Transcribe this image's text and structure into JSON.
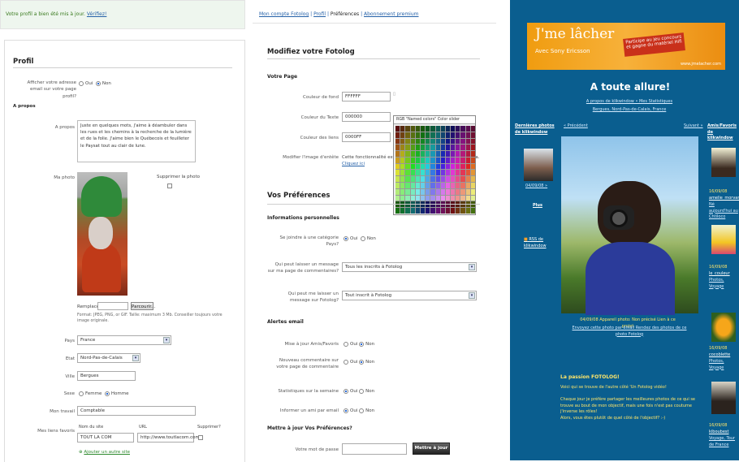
{
  "profile_panel": {
    "message": "Votre profil a bien été mis à jour.",
    "message_link": "Vérifiez!",
    "section_title": "Profil",
    "email_question": "Afficher votre adresse email sur votre page profil?",
    "radio_oui": "Oui",
    "radio_non": "Non",
    "apropos_heading": "A propos",
    "apropos_label": "A propos",
    "apropos_text": "Juste en quelques mots, j'aime à déambuler dans les rues et les chemins à la recherche de la lumière et de la folie. J'aime bien le Québecois et feuilleter le Paysat tout au clair de lune.",
    "photo_label": "Ma photo",
    "delete_photo": "Supprimer la photo",
    "browse_label": "Remplacer",
    "browse_button": "Parcourir...",
    "photo_hint": "Format: JPEG, PNG, or GIF. Taille: maximum 3 Mb. Conseiller toujours votre image originale.",
    "country_label": "Pays",
    "country_value": "France",
    "state_label": "Etat",
    "state_value": "Nord-Pas-de-Calais",
    "city_label": "Ville",
    "city_value": "Bergues",
    "sex_label": "Sexe",
    "sex_f": "Femme",
    "sex_m": "Homme",
    "job_label": "Mon travail",
    "job_value": "Comptable",
    "fav_label": "Mes liens favoris",
    "fav_col_name": "Nom du site",
    "fav_col_url": "URL",
    "fav_col_del": "Supprimer?",
    "fav_name": "TOUT LA COM",
    "fav_url": "http://www.toutlacom.com",
    "add_site": "Ajouter un autre site"
  },
  "prefs_panel": {
    "nav_account": "Mon compte Fotolog",
    "nav_profile": "Profil",
    "nav_prefs": "Préférences",
    "nav_premium": "Abonnement premium",
    "title": "Modifiez votre Fotolog",
    "page_heading": "Votre Page",
    "bg_label": "Couleur de fond",
    "bg_value": "FFFFFF",
    "text_label": "Couleur du Texte",
    "text_value": "000000",
    "link_label": "Couleur des liens",
    "link_value": "0000FF",
    "header_label": "Modifier l'image d'entête",
    "header_text": "Cette fonctionnalité est réservée aux membres Gold Camera.",
    "header_link": "Cliquez ici",
    "swatch_header": "RGB \"Named colors\" Color slider",
    "prefs_title": "Vos Préférences",
    "personal_heading": "Informations personnelles",
    "category_label": "Se joindre à une catégorie Pays?",
    "msg_label": "Qui peut laisser un message sur ma page de commentaires?",
    "msg_value": "Tous les inscrits à Fotolog",
    "leave_label": "Qui peut me laisser un message sur Fotolog?",
    "leave_value": "Tout inscrit à Fotolog",
    "alerts_heading": "Alertes email",
    "friends_label": "Mise à jour Amis/Favoris",
    "comment_label": "Nouveau commentaire sur votre page de commentaire",
    "stats_label": "Statistiques sur la semaine",
    "friend_email_label": "Informer un ami par email",
    "oui": "Oui",
    "non": "Non",
    "update_heading": "Mettre à jour Vos Préférences?",
    "password_label": "Votre mot de passe",
    "update_button": "Mettre à jour"
  },
  "fotolog_panel": {
    "banner_title": "J'me lâcher",
    "banner_sub": "Avec Sony Ericsson",
    "banner_promo": "Participe au jeu concours et gagne du matériel Hifi",
    "banner_url": "www.jmelacher.com",
    "page_title": "A toute allure!",
    "author_line": "A propos de klikwindow • Mes Statistiques",
    "location_line": "Bergues, Nord-Pas-de-Calais, France",
    "left_title": "Dernières photos de klikwindow",
    "prev": "« Précédent",
    "next": "Suivant »",
    "right_title": "Amis/Favoris de klikwindow",
    "thumb_date": "04/09/08 »",
    "thumb_more": "Plus",
    "rss": "RSS de klikwindow",
    "caption": "04/09/08  Appareil photo: Non précisé  Lien à ce projet",
    "caption2": "Envoyez cette photo par email  Rendez des photos de ce photo Fotolog",
    "passion_title": "La passion FOTOLOG!",
    "passion_p1": "Voici qui se trouve de l'autre côté 'Un Fotolog vidéo!",
    "passion_p2": "Chaque jour je préfère partager les meilleures photos de ce qui se trouve au bout de mon objectif, mais une fois n'est pas coutume j'inverse les rôles!",
    "passion_p3": "Alors, vous êtes plutôt de quel côté de l'objectif? :-)",
    "friend1_date": "16/09/08",
    "friend1_name": "amelie_morvan",
    "friend1_loc": "Né aujourd'hui au Chtiloco",
    "friend2_date": "16/09/08",
    "friend2_name": "le_couleur",
    "friend2_loc": "Photos, Voyage",
    "friend3_date": "16/09/08",
    "friend3_name": "cocoblette",
    "friend3_loc": "Photos, Voyage",
    "friend4_date": "16/09/08",
    "friend4_name": "kiboubest",
    "friend4_loc": "Voyage, Tour de France"
  },
  "colors": {
    "page_bg": "#FFFFFF",
    "fotolog_bg": "#0A5E8F",
    "banner_orange": "#F09C10",
    "accent_link": "#2561A8",
    "message_green": "#3A7B1F"
  }
}
